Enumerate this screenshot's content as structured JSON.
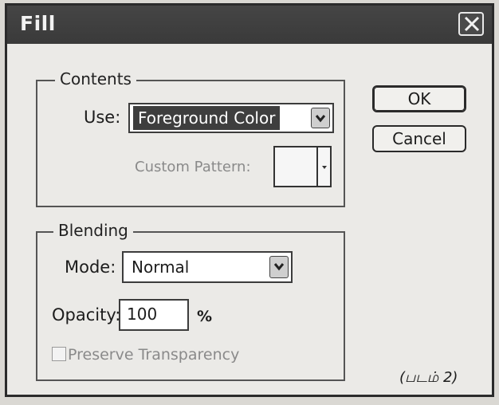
{
  "window": {
    "title": "Fill"
  },
  "contents_group": {
    "legend": "Contents",
    "use_label": "Use:",
    "use_value": "Foreground Color",
    "custom_pattern_label": "Custom Pattern:"
  },
  "blending_group": {
    "legend": "Blending",
    "mode_label": "Mode:",
    "mode_value": "Normal",
    "opacity_label": "Opacity:",
    "opacity_value": "100",
    "opacity_unit": "%",
    "preserve_label": "Preserve Transparency",
    "preserve_checked": false
  },
  "buttons": {
    "ok": "OK",
    "cancel": "Cancel"
  },
  "caption": "(படம் 2)",
  "icons": {
    "close": "close-icon",
    "dropdown": "chevron-down-icon"
  }
}
